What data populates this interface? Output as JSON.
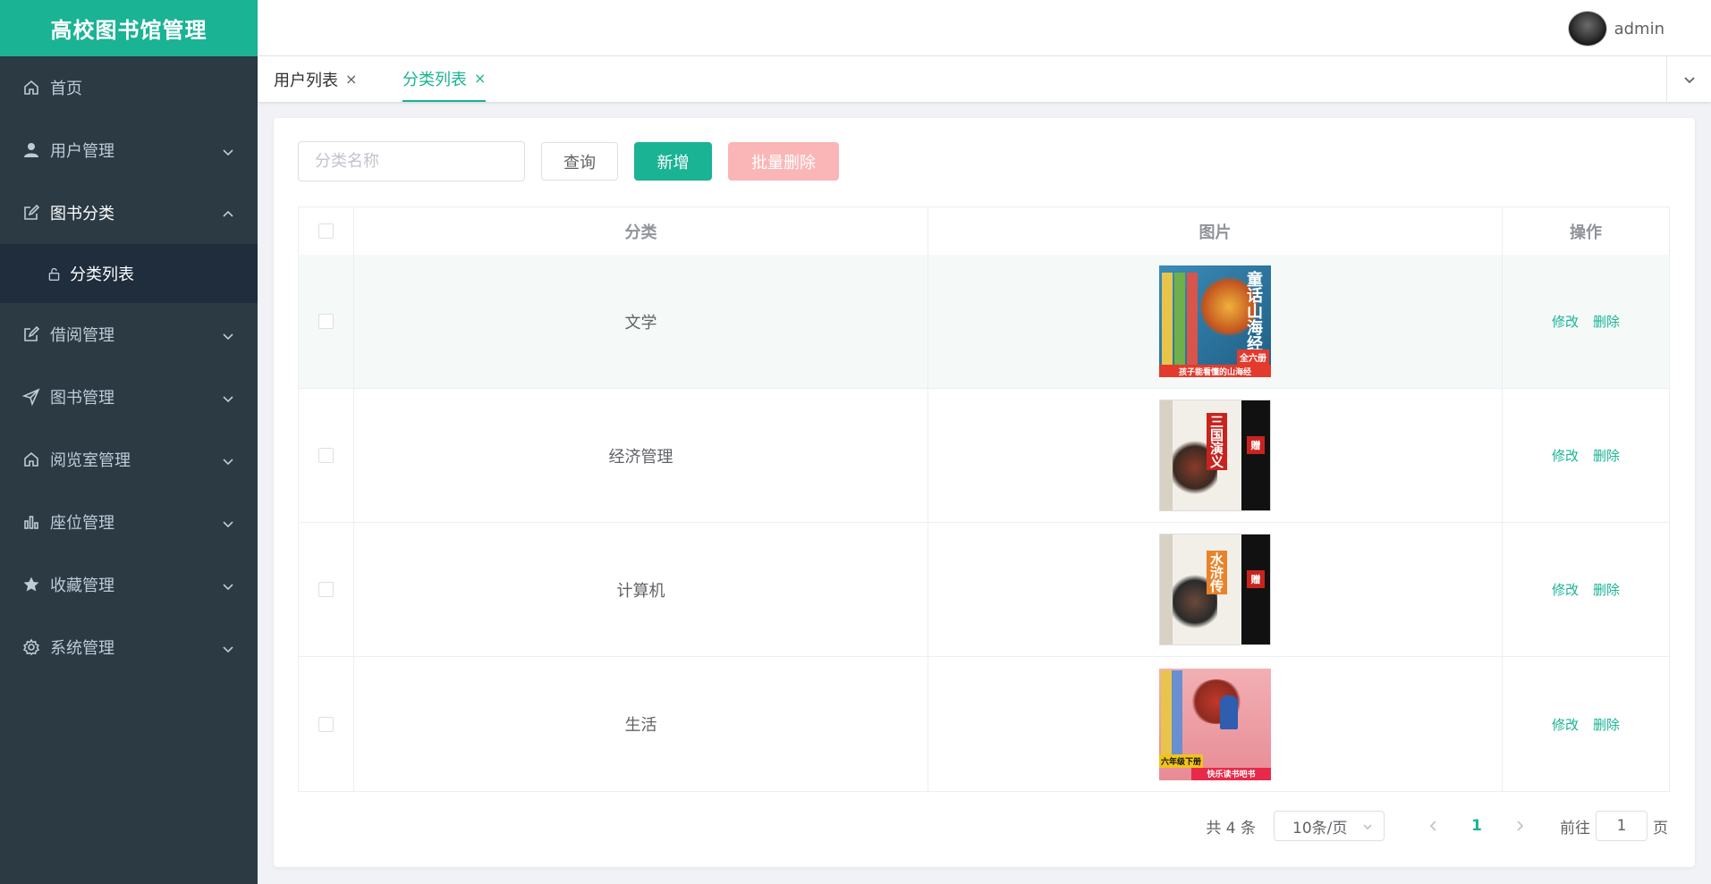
{
  "app": {
    "title": "高校图书馆管理"
  },
  "header": {
    "username": "admin"
  },
  "sidebar": {
    "items": [
      {
        "label": "首页",
        "icon": "home-icon"
      },
      {
        "label": "用户管理",
        "icon": "user-icon"
      },
      {
        "label": "图书分类",
        "icon": "edit-icon",
        "open": true,
        "children": [
          {
            "label": "分类列表",
            "icon": "lock-icon"
          }
        ]
      },
      {
        "label": "借阅管理",
        "icon": "edit-icon"
      },
      {
        "label": "图书管理",
        "icon": "send-icon"
      },
      {
        "label": "阅览室管理",
        "icon": "home-icon"
      },
      {
        "label": "座位管理",
        "icon": "bar-chart-icon"
      },
      {
        "label": "收藏管理",
        "icon": "star-icon"
      },
      {
        "label": "系统管理",
        "icon": "gear-icon"
      }
    ]
  },
  "tabs": [
    {
      "label": "用户列表",
      "close": "×",
      "active": false
    },
    {
      "label": "分类列表",
      "close": "×",
      "active": true
    }
  ],
  "toolbar": {
    "search_placeholder": "分类名称",
    "query_label": "查询",
    "add_label": "新增",
    "batch_delete_label": "批量删除"
  },
  "table": {
    "columns": [
      "分类",
      "图片",
      "操作"
    ],
    "rows": [
      {
        "category": "文学",
        "edit": "修改",
        "delete": "删除",
        "cover": {
          "title": "童话山海经",
          "band": "孩子能看懂的山海经",
          "tag": "全六册",
          "bg": "#2f7fa8",
          "accent": "#e23b2e"
        }
      },
      {
        "category": "经济管理",
        "edit": "修改",
        "delete": "删除",
        "cover": {
          "title": "三国演义",
          "band": "",
          "tag": "赠",
          "bg": "#f2efe8",
          "accent": "#c8231e"
        }
      },
      {
        "category": "计算机",
        "edit": "修改",
        "delete": "删除",
        "cover": {
          "title": "水浒传",
          "band": "",
          "tag": "赠",
          "bg": "#f2efe8",
          "accent": "#e8832a"
        }
      },
      {
        "category": "生活",
        "edit": "修改",
        "delete": "删除",
        "cover": {
          "title": "快乐读书吧书",
          "band": "快乐读书吧书",
          "tag": "六年级下册",
          "bg": "#e9a0a6",
          "accent": "#e8294a"
        }
      }
    ]
  },
  "pagination": {
    "total": "共 4 条",
    "page_size": "10条/页",
    "current_page": "1",
    "goto_prefix": "前往",
    "goto_value": "1",
    "goto_suffix": "页"
  },
  "colors": {
    "primary": "#1ab394",
    "sidebar_bg": "#2b3a43",
    "danger_disabled": "#fab6b6"
  }
}
